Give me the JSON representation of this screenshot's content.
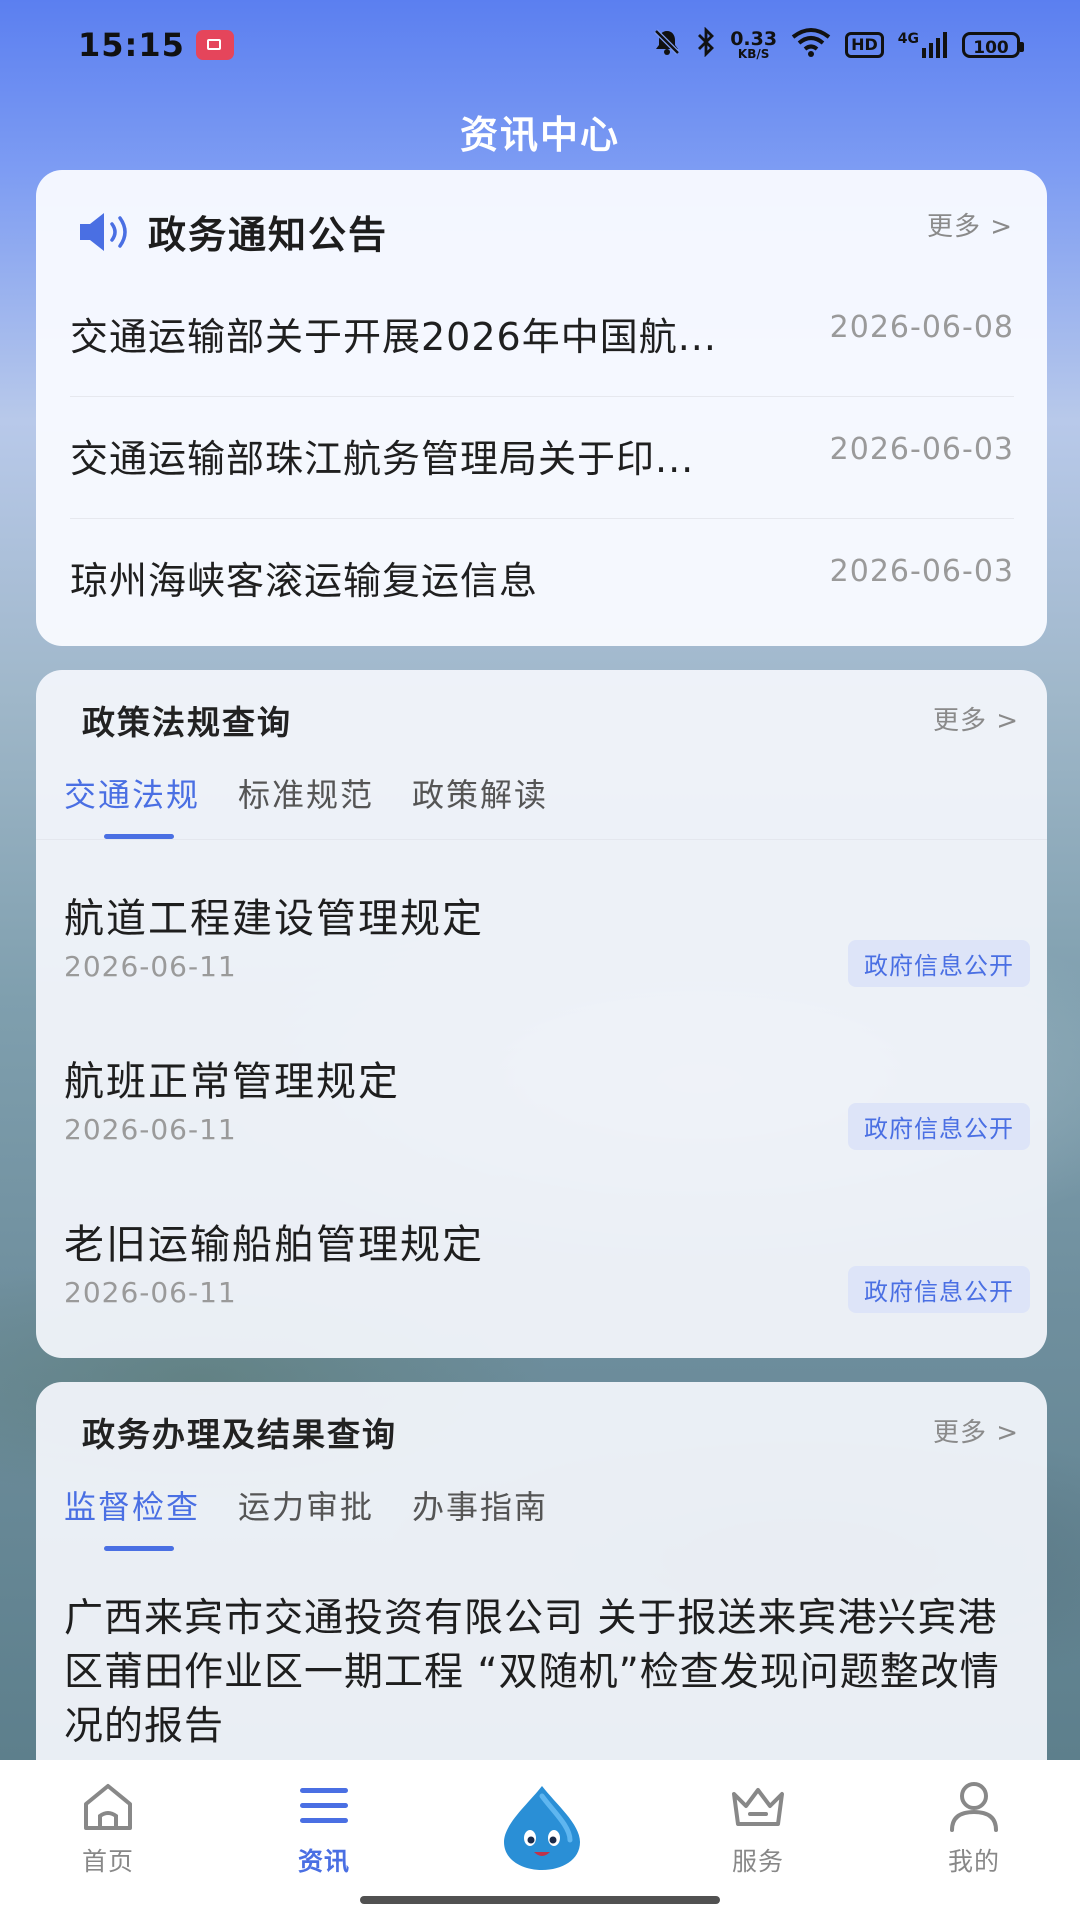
{
  "status_bar": {
    "time": "15:15",
    "speed_value": "0.33",
    "speed_unit": "KB/S",
    "hd_label": "HD",
    "network_label": "4G",
    "battery": "100"
  },
  "page_title": "资讯中心",
  "notice": {
    "title": "政务通知公告",
    "more": "更多 >",
    "items": [
      {
        "title": "交通运输部关于开展2026年中国航...",
        "date": "2026-06-08"
      },
      {
        "title": "交通运输部珠江航务管理局关于印...",
        "date": "2026-06-03"
      },
      {
        "title": "琼州海峡客滚运输复运信息",
        "date": "2026-06-03"
      }
    ]
  },
  "policy": {
    "title": "政策法规查询",
    "more": "更多 >",
    "tabs": [
      "交通法规",
      "标准规范",
      "政策解读"
    ],
    "active_tab": "交通法规",
    "items": [
      {
        "title": "航道工程建设管理规定",
        "date": "2026-06-11",
        "badge": "政府信息公开"
      },
      {
        "title": "航班正常管理规定",
        "date": "2026-06-11",
        "badge": "政府信息公开"
      },
      {
        "title": "老旧运输船舶管理规定",
        "date": "2026-06-11",
        "badge": "政府信息公开"
      }
    ]
  },
  "affairs": {
    "title": "政务办理及结果查询",
    "more": "更多 >",
    "tabs": [
      "监督检查",
      "运力审批",
      "办事指南"
    ],
    "active_tab": "监督检查",
    "first_item": "广西来宾市交通投资有限公司 关于报送来宾港兴宾港区莆田作业区一期工程 “双随机”检查发现问题整改情况的报告"
  },
  "bottom_nav": {
    "items": [
      {
        "label": "首页",
        "icon": "home-icon"
      },
      {
        "label": "资讯",
        "icon": "menu-icon"
      },
      {
        "label": "",
        "icon": "mascot-icon"
      },
      {
        "label": "服务",
        "icon": "crown-icon"
      },
      {
        "label": "我的",
        "icon": "user-icon"
      }
    ],
    "active": "资讯"
  },
  "colors": {
    "accent": "#4a6fe3",
    "header_blue": "#5b7ff0",
    "badge_bg": "#dde4f8",
    "recording_red": "#e5455b"
  }
}
